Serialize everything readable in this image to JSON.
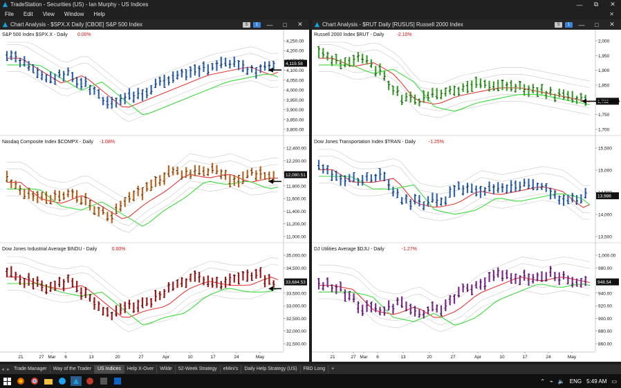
{
  "app": {
    "title": "TradeStation - Securities (US) - Ian Murphy - US Indices",
    "minimize": "—",
    "maximize": "⧉",
    "close": "✕"
  },
  "menu": [
    "File",
    "Edit",
    "View",
    "Window",
    "Help"
  ],
  "menu_close": "✕",
  "windows": [
    {
      "title": "Chart Analysis - $SPX.X Daily [CBOE] S&P 500 Index",
      "x_labels": [
        "21",
        "27",
        "Mar",
        "6",
        "13",
        "20",
        "27",
        "Apr",
        "10",
        "17",
        "24",
        "May"
      ],
      "panels": [
        {
          "label": "S&P 500 Index  $SPX.X - Daily",
          "change": "0.00%",
          "price": "4,119.58",
          "ticks": [
            "4,250.00",
            "4,200.00",
            "4,150.00",
            "4,100.00",
            "4,050.00",
            "4,000.00",
            "3,950.00",
            "3,900.00",
            "3,850.00",
            "3,800.00"
          ],
          "color": "#2f63b0"
        },
        {
          "label": "Nasdaq Composite Index  $COMPX - Daily",
          "change": "-1.08%",
          "price": "12,080.51",
          "ticks": [
            "12,400.00",
            "12,200.00",
            "12,000.00",
            "11,800.00",
            "11,600.00",
            "11,400.00",
            "11,200.00",
            "11,000.00"
          ],
          "color": "#b8641c"
        },
        {
          "label": "Dow Jones Industrial Average  $INDU - Daily",
          "change": "0.00%",
          "price": "33,684.53",
          "ticks": [
            "35,000.00",
            "34,500.00",
            "34,000.00",
            "33,500.00",
            "33,000.00",
            "32,500.00",
            "32,000.00",
            "31,500.00"
          ],
          "color": "#a01818"
        }
      ]
    },
    {
      "title": "Chart Analysis - $RUT Daily [RUSUS] Russell 2000 Index",
      "x_labels": [
        "21",
        "27",
        "Mar",
        "6",
        "13",
        "20",
        "27",
        "Apr",
        "10",
        "17",
        "24",
        "May"
      ],
      "panels": [
        {
          "label": "Russell 2000 Index  $RUT - Daily",
          "change": "-2.10%",
          "price": "1,732",
          "ticks": [
            "2,000",
            "1,950",
            "1,900",
            "1,850",
            "1,800",
            "1,750",
            "1,700"
          ],
          "color": "#3aa02a"
        },
        {
          "label": "Dow Jones Transportation Index  $TRAN - Daily",
          "change": "-1.25%",
          "price": "13,986",
          "ticks": [
            "15,500",
            "15,000",
            "14,500",
            "14,000",
            "13,500"
          ],
          "color": "#2f63b0"
        },
        {
          "label": "DJ Utilities Average  $DJU - Daily",
          "change": "-1.27%",
          "price": "948.54",
          "ticks": [
            "1,000.00",
            "980.00",
            "960.00",
            "940.00",
            "920.00",
            "900.00",
            "880.00",
            "860.00"
          ],
          "color": "#7a2a8a"
        }
      ]
    }
  ],
  "tabs": [
    "Trade Manager",
    "Way of the Trader",
    "US Indices",
    "Help X-Over",
    "Wilde",
    "52-Week Strategy",
    "eMini's",
    "Daily Help Strategy (US)",
    "FBD Long",
    "+"
  ],
  "active_tab": "US Indices",
  "taskbar": {
    "lang": "ENG",
    "time": "5:49 AM"
  }
}
